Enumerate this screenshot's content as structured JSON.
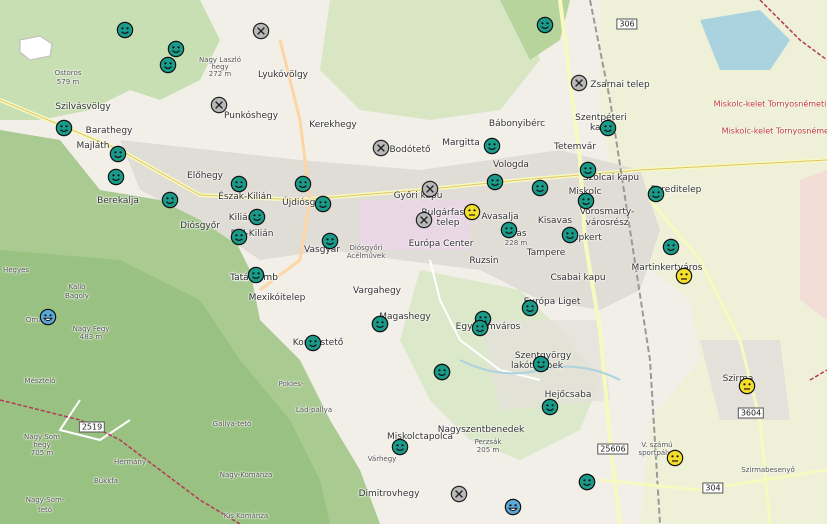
{
  "marker_colors": {
    "green": "#1a9b8a",
    "yellow": "#f3de2c",
    "blue": "#5aa9d8",
    "gray": "#b8b8b8"
  },
  "labels": [
    {
      "t": "Ostoros",
      "s": "small"
    },
    {
      "t": "579 m",
      "s": "small"
    },
    {
      "t": "Nagy Laszló",
      "s": "small"
    },
    {
      "t": "hegy",
      "s": "small"
    },
    {
      "t": "272 m",
      "s": "small"
    },
    {
      "t": "Szilvásvölgy"
    },
    {
      "t": "Lyukóvölgy"
    },
    {
      "t": "Punkóshegy"
    },
    {
      "t": "Barathegy"
    },
    {
      "t": "Majláth"
    },
    {
      "t": "Kerekhegy"
    },
    {
      "t": "Bodótető"
    },
    {
      "t": "Margitta"
    },
    {
      "t": "Bábonyibérc"
    },
    {
      "t": "Szentpéteri"
    },
    {
      "t": "kapu"
    },
    {
      "t": "Zsarnai telep"
    },
    {
      "t": "Tetemvár"
    },
    {
      "t": "Vologda"
    },
    {
      "t": "Miskolc"
    },
    {
      "t": "Szolcai kapu"
    },
    {
      "t": "Pereditelep"
    },
    {
      "t": "Előhegy"
    },
    {
      "t": "Berekalja"
    },
    {
      "t": "Észak-Kilián"
    },
    {
      "t": "Újdiósgyőr"
    },
    {
      "t": "Győri kapu"
    },
    {
      "t": "Diósgyőr"
    },
    {
      "t": "Kilián"
    },
    {
      "t": "Dél-Kilián"
    },
    {
      "t": "Vasgyár"
    },
    {
      "t": "Bulgárfaszi-"
    },
    {
      "t": "telep"
    },
    {
      "t": "Avasalja"
    },
    {
      "t": "Avas"
    },
    {
      "t": "228 m",
      "s": "small"
    },
    {
      "t": "Kisavas"
    },
    {
      "t": "Vorosmarty-"
    },
    {
      "t": "városrész"
    },
    {
      "t": "Népkert"
    },
    {
      "t": "Martinkertváros"
    },
    {
      "t": "Európa Center"
    },
    {
      "t": "Tampere"
    },
    {
      "t": "Ruzsin"
    },
    {
      "t": "Csabai kapu"
    },
    {
      "t": "Tatárdomb"
    },
    {
      "t": "Mexikóitelep"
    },
    {
      "t": "Vargahegy"
    },
    {
      "t": "Európa Liget"
    },
    {
      "t": "Hegyes",
      "s": "small"
    },
    {
      "t": "Magashegy"
    },
    {
      "t": "Egyetemváros"
    },
    {
      "t": "Bagoly",
      "s": "small"
    },
    {
      "t": "Kalló",
      "s": "small"
    },
    {
      "t": "Nagy Fegy",
      "s": "small"
    },
    {
      "t": "483 m",
      "s": "small"
    },
    {
      "t": "Komlóstető"
    },
    {
      "t": "Szentgyörgy"
    },
    {
      "t": "lakótelepek"
    },
    {
      "t": "Mészteló",
      "s": "small"
    },
    {
      "t": "Pokles-",
      "s": "small"
    },
    {
      "t": "Szirma"
    },
    {
      "t": "Hejőcsaba"
    },
    {
      "t": "Lád-pallya",
      "s": "small"
    },
    {
      "t": "Gallya-tető",
      "s": "small"
    },
    {
      "t": "Miskolctapolca"
    },
    {
      "t": "Nagyszentbenedek"
    },
    {
      "t": "Nagy Som",
      "s": "small"
    },
    {
      "t": "hegy",
      "s": "small"
    },
    {
      "t": "705 m",
      "s": "small"
    },
    {
      "t": "Várhegy",
      "s": "small"
    },
    {
      "t": "Perzsák",
      "s": "small"
    },
    {
      "t": "205 m",
      "s": "small"
    },
    {
      "t": "Szirmabesenyő",
      "s": "small"
    },
    {
      "t": "Dimitrovhegy"
    },
    {
      "t": "Nagy-Kománza",
      "s": "small"
    },
    {
      "t": "Bükkfa",
      "s": "small"
    },
    {
      "t": "Kis Kománza",
      "s": "small"
    },
    {
      "t": "Nagy-Som-",
      "s": "small"
    },
    {
      "t": "tető",
      "s": "small"
    },
    {
      "t": "Tatárdomb"
    },
    {
      "t": "Hermány",
      "s": "small"
    },
    {
      "t": "Miskolc-kelet Tornyosnémeti",
      "s": "rail"
    },
    {
      "t": "Miskolc-kelet Tornyosnémeti",
      "s": "rail"
    },
    {
      "t": "V. számú",
      "s": "small"
    },
    {
      "t": "sportpálya",
      "s": "small"
    },
    {
      "t": "Ómassa",
      "s": "small"
    },
    {
      "t": "Diósgyőri",
      "s": "small"
    },
    {
      "t": "Acélművek",
      "s": "small"
    }
  ],
  "shields": [
    "306",
    "2519",
    "25606",
    "304",
    "3604"
  ],
  "markers": [
    {
      "c": "green",
      "k": "smile"
    },
    {
      "c": "gray",
      "k": "x"
    },
    {
      "c": "green",
      "k": "smile"
    },
    {
      "c": "green",
      "k": "smile"
    },
    {
      "c": "green",
      "k": "smile"
    },
    {
      "c": "green",
      "k": "smile"
    },
    {
      "c": "gray",
      "k": "x"
    },
    {
      "c": "green",
      "k": "smile"
    },
    {
      "c": "gray",
      "k": "x"
    },
    {
      "c": "green",
      "k": "smile"
    },
    {
      "c": "gray",
      "k": "x"
    },
    {
      "c": "green",
      "k": "smile"
    },
    {
      "c": "green",
      "k": "smile"
    },
    {
      "c": "green",
      "k": "smile"
    },
    {
      "c": "green",
      "k": "smile"
    },
    {
      "c": "green",
      "k": "smile"
    },
    {
      "c": "green",
      "k": "smile"
    },
    {
      "c": "green",
      "k": "smile"
    },
    {
      "c": "green",
      "k": "smile"
    },
    {
      "c": "green",
      "k": "smile"
    },
    {
      "c": "green",
      "k": "smile"
    },
    {
      "c": "gray",
      "k": "x"
    },
    {
      "c": "green",
      "k": "smile"
    },
    {
      "c": "green",
      "k": "smile"
    },
    {
      "c": "green",
      "k": "smile"
    },
    {
      "c": "green",
      "k": "smile"
    },
    {
      "c": "green",
      "k": "smile"
    },
    {
      "c": "gray",
      "k": "x"
    },
    {
      "c": "yellow",
      "k": "neutral"
    },
    {
      "c": "green",
      "k": "smile"
    },
    {
      "c": "green",
      "k": "smile"
    },
    {
      "c": "green",
      "k": "smile"
    },
    {
      "c": "green",
      "k": "smile"
    },
    {
      "c": "green",
      "k": "smile"
    },
    {
      "c": "green",
      "k": "smile"
    },
    {
      "c": "yellow",
      "k": "neutral"
    },
    {
      "c": "blue",
      "k": "grin"
    },
    {
      "c": "green",
      "k": "smile"
    },
    {
      "c": "green",
      "k": "smile"
    },
    {
      "c": "green",
      "k": "smile"
    },
    {
      "c": "green",
      "k": "smile"
    },
    {
      "c": "green",
      "k": "smile"
    },
    {
      "c": "green",
      "k": "smile"
    },
    {
      "c": "green",
      "k": "smile"
    },
    {
      "c": "yellow",
      "k": "neutral"
    },
    {
      "c": "green",
      "k": "smile"
    },
    {
      "c": "green",
      "k": "smile"
    },
    {
      "c": "yellow",
      "k": "neutral"
    },
    {
      "c": "green",
      "k": "smile"
    },
    {
      "c": "gray",
      "k": "x"
    },
    {
      "c": "blue",
      "k": "grin"
    }
  ]
}
